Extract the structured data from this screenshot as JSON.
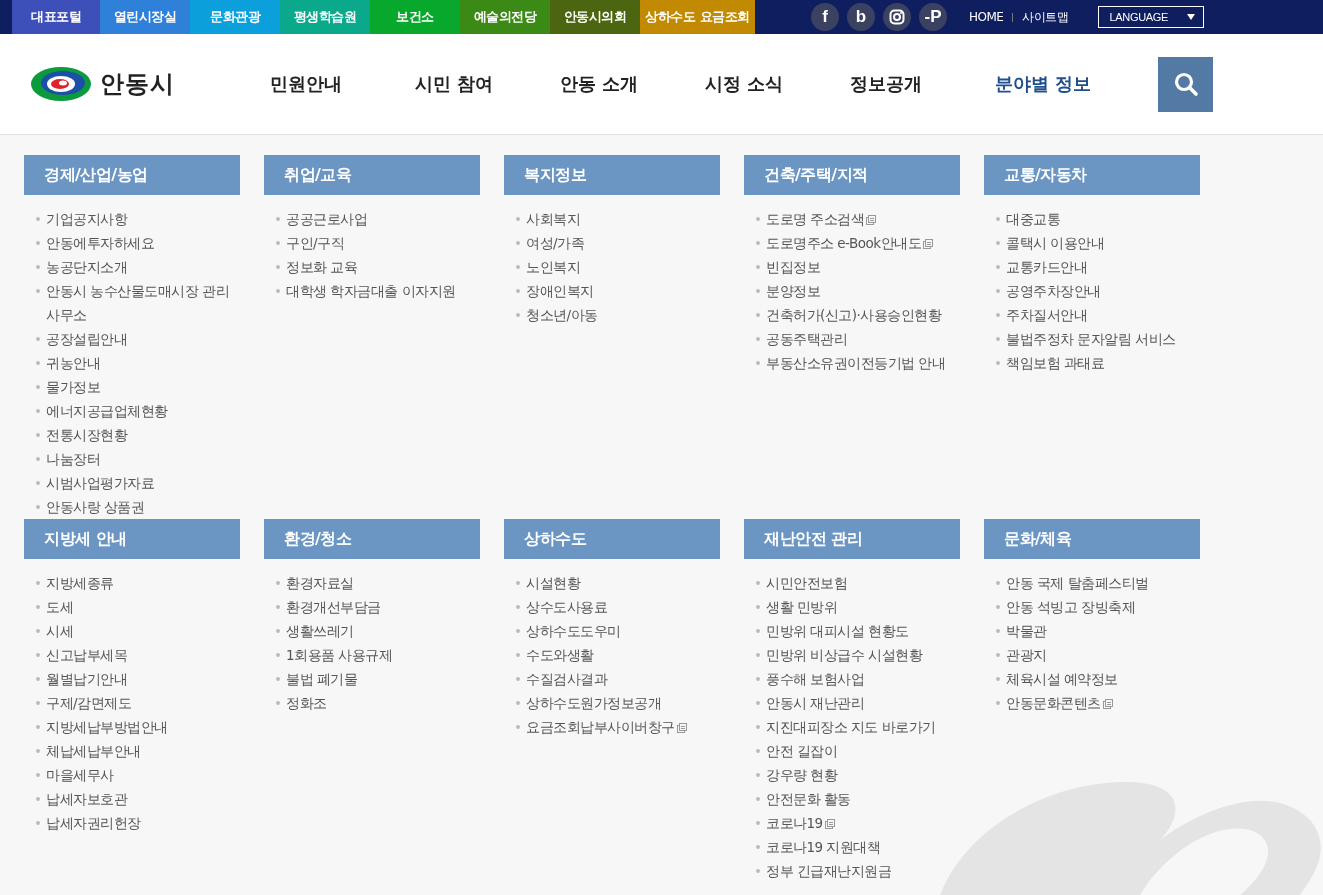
{
  "top_links": [
    {
      "label": "대표포털",
      "color": "#3d4fb8"
    },
    {
      "label": "열린시장실",
      "color": "#2f80d8"
    },
    {
      "label": "문화관광",
      "color": "#0ba0dc"
    },
    {
      "label": "평생학습원",
      "color": "#0aa98c"
    },
    {
      "label": "보건소",
      "color": "#08a82c"
    },
    {
      "label": "예술의전당",
      "color": "#3b8a16"
    },
    {
      "label": "안동시의회",
      "color": "#4b6510"
    },
    {
      "label": "상하수도 요금조회",
      "color": "#c28a00"
    }
  ],
  "social": [
    {
      "kind": "letter",
      "glyph": "f"
    },
    {
      "kind": "letter",
      "glyph": "b"
    },
    {
      "kind": "instagram"
    },
    {
      "kind": "letter",
      "glyph": "-P"
    }
  ],
  "utility_links": [
    "HOME",
    "사이트맵"
  ],
  "language": {
    "label": "LANGUAGE"
  },
  "logo": {
    "text": "안동시"
  },
  "nav": [
    {
      "label": "민원안내",
      "selected": false
    },
    {
      "label": "시민 참여",
      "selected": false
    },
    {
      "label": "안동 소개",
      "selected": false
    },
    {
      "label": "시정 소식",
      "selected": false
    },
    {
      "label": "정보공개",
      "selected": false
    },
    {
      "label": "분야별 정보",
      "selected": true
    }
  ],
  "sections": [
    {
      "title": "경제/산업/농업",
      "items": [
        {
          "label": "기업공지사항",
          "external": false
        },
        {
          "label": "안동에투자하세요",
          "external": false
        },
        {
          "label": "농공단지소개",
          "external": false
        },
        {
          "label": "안동시 농수산물도매시장 관리사무소",
          "external": false
        },
        {
          "label": "공장설립안내",
          "external": false
        },
        {
          "label": "귀농안내",
          "external": false
        },
        {
          "label": "물가정보",
          "external": false
        },
        {
          "label": "에너지공급업체현황",
          "external": false
        },
        {
          "label": "전통시장현황",
          "external": false
        },
        {
          "label": "나눔장터",
          "external": false
        },
        {
          "label": "시범사업평가자료",
          "external": false
        },
        {
          "label": "안동사랑 상품권",
          "external": false
        }
      ]
    },
    {
      "title": "취업/교육",
      "items": [
        {
          "label": "공공근로사업",
          "external": false
        },
        {
          "label": "구인/구직",
          "external": false
        },
        {
          "label": "정보화 교육",
          "external": false
        },
        {
          "label": "대학생 학자금대출 이자지원",
          "external": false
        }
      ]
    },
    {
      "title": "복지정보",
      "items": [
        {
          "label": "사회복지",
          "external": false
        },
        {
          "label": "여성/가족",
          "external": false
        },
        {
          "label": "노인복지",
          "external": false
        },
        {
          "label": "장애인복지",
          "external": false
        },
        {
          "label": "청소년/아동",
          "external": false
        }
      ]
    },
    {
      "title": "건축/주택/지적",
      "items": [
        {
          "label": "도로명 주소검색",
          "external": true
        },
        {
          "label": "도로명주소 e-Book안내도",
          "external": true
        },
        {
          "label": "빈집정보",
          "external": false
        },
        {
          "label": "분양정보",
          "external": false
        },
        {
          "label": "건축허가(신고)·사용승인현황",
          "external": false
        },
        {
          "label": "공동주택관리",
          "external": false
        },
        {
          "label": "부동산소유권이전등기법 안내",
          "external": false
        }
      ]
    },
    {
      "title": "교통/자동차",
      "items": [
        {
          "label": "대중교통",
          "external": false
        },
        {
          "label": "콜택시 이용안내",
          "external": false
        },
        {
          "label": "교통카드안내",
          "external": false
        },
        {
          "label": "공영주차장안내",
          "external": false
        },
        {
          "label": "주차질서안내",
          "external": false
        },
        {
          "label": "불법주정차 문자알림 서비스",
          "external": false
        },
        {
          "label": "책임보험 과태료",
          "external": false
        }
      ]
    },
    {
      "title": "지방세 안내",
      "items": [
        {
          "label": "지방세종류",
          "external": false
        },
        {
          "label": "도세",
          "external": false
        },
        {
          "label": "시세",
          "external": false
        },
        {
          "label": "신고납부세목",
          "external": false
        },
        {
          "label": "월별납기안내",
          "external": false
        },
        {
          "label": "구제/감면제도",
          "external": false
        },
        {
          "label": "지방세납부방법안내",
          "external": false
        },
        {
          "label": "체납세납부안내",
          "external": false
        },
        {
          "label": "마을세무사",
          "external": false
        },
        {
          "label": "납세자보호관",
          "external": false
        },
        {
          "label": "납세자권리헌장",
          "external": false
        }
      ]
    },
    {
      "title": "환경/청소",
      "items": [
        {
          "label": "환경자료실",
          "external": false
        },
        {
          "label": "환경개선부담금",
          "external": false
        },
        {
          "label": "생활쓰레기",
          "external": false
        },
        {
          "label": "1회용품 사용규제",
          "external": false
        },
        {
          "label": "불법 폐기물",
          "external": false
        },
        {
          "label": "정화조",
          "external": false
        }
      ]
    },
    {
      "title": "상하수도",
      "items": [
        {
          "label": "시설현황",
          "external": false
        },
        {
          "label": "상수도사용료",
          "external": false
        },
        {
          "label": "상하수도도우미",
          "external": false
        },
        {
          "label": "수도와생활",
          "external": false
        },
        {
          "label": "수질검사결과",
          "external": false
        },
        {
          "label": "상하수도원가정보공개",
          "external": false
        },
        {
          "label": "요금조회납부사이버창구",
          "external": true
        }
      ]
    },
    {
      "title": "재난안전 관리",
      "items": [
        {
          "label": "시민안전보험",
          "external": false
        },
        {
          "label": "생활 민방위",
          "external": false
        },
        {
          "label": "민방위 대피시설 현황도",
          "external": false
        },
        {
          "label": "민방위 비상급수 시설현황",
          "external": false
        },
        {
          "label": "풍수해 보험사업",
          "external": false
        },
        {
          "label": "안동시 재난관리",
          "external": false
        },
        {
          "label": "지진대피장소 지도 바로가기",
          "external": false
        },
        {
          "label": "안전 길잡이",
          "external": false
        },
        {
          "label": "강우량 현황",
          "external": false
        },
        {
          "label": "안전문화 활동",
          "external": false
        },
        {
          "label": "코로나19",
          "external": true
        },
        {
          "label": "코로나19 지원대책",
          "external": false
        },
        {
          "label": "정부 긴급재난지원금",
          "external": false
        }
      ]
    },
    {
      "title": "문화/체육",
      "items": [
        {
          "label": "안동 국제 탈춤페스티벌",
          "external": false
        },
        {
          "label": "안동 석빙고 장빙축제",
          "external": false
        },
        {
          "label": "박물관",
          "external": false
        },
        {
          "label": "관광지",
          "external": false
        },
        {
          "label": "체육시설 예약정보",
          "external": false
        },
        {
          "label": "안동문화콘텐츠",
          "external": true
        }
      ]
    }
  ]
}
